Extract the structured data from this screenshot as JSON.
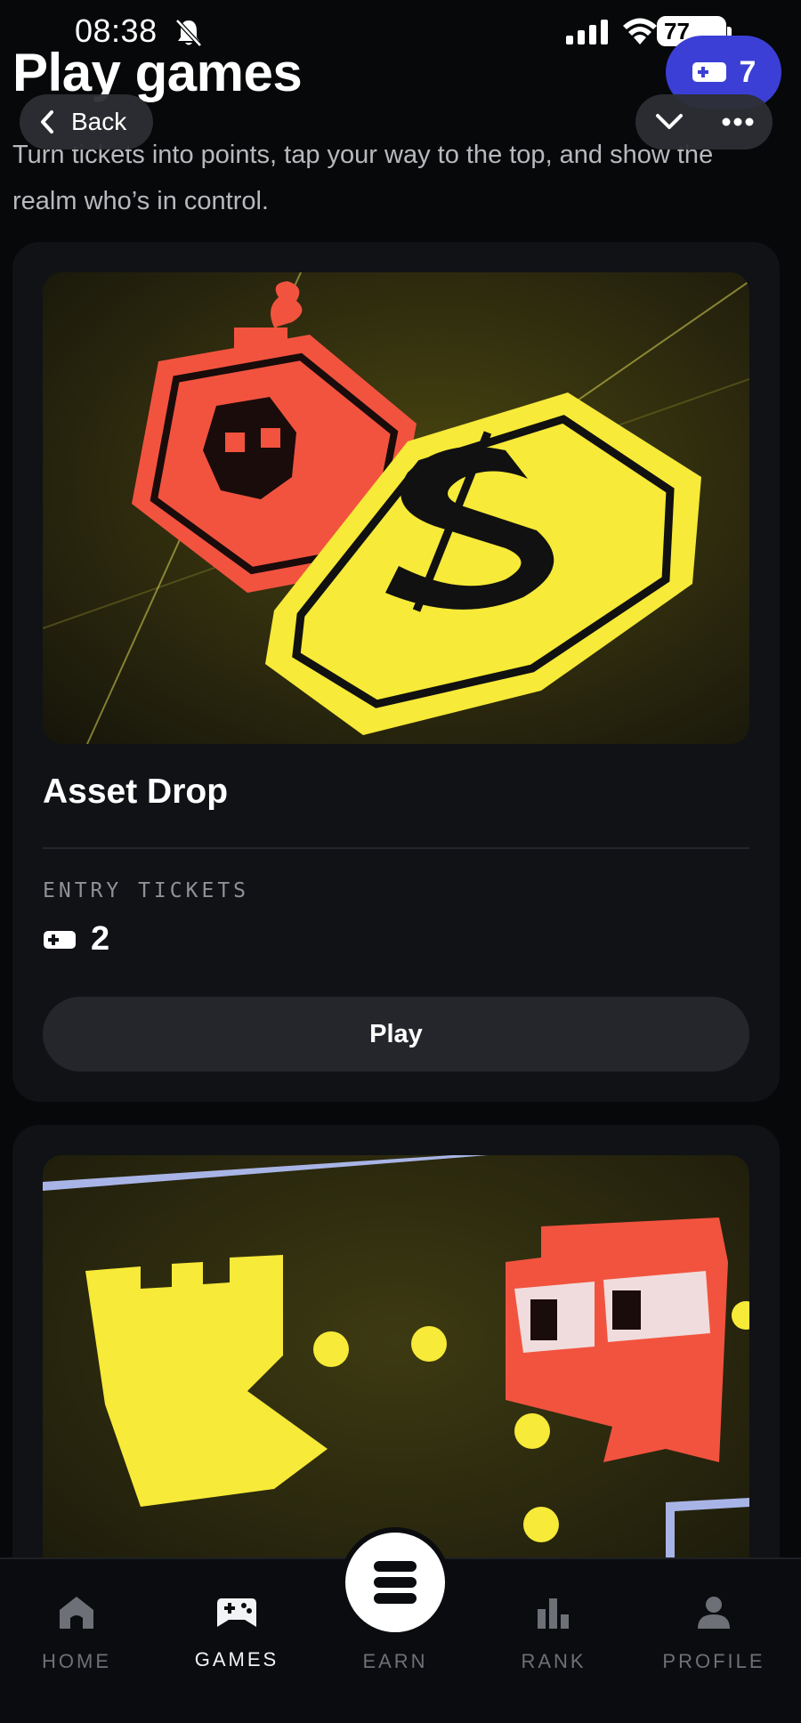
{
  "status_bar": {
    "time": "08:38",
    "battery": "77"
  },
  "header": {
    "title": "Play games",
    "subtitle": "Turn tickets into points, tap your way to the top, and show the realm who’s in control.",
    "ticket_count": "7",
    "back_label": "Back"
  },
  "games": [
    {
      "title": "Asset Drop",
      "entry_label": "ENTRY TICKETS",
      "entry_value": "2",
      "play_label": "Play"
    }
  ],
  "nav": {
    "items": [
      {
        "label": "HOME"
      },
      {
        "label": "GAMES"
      },
      {
        "label": "EARN"
      },
      {
        "label": "RANK"
      },
      {
        "label": "PROFILE"
      }
    ],
    "active": "GAMES"
  },
  "colors": {
    "accent": "#3b3fd6",
    "background": "#070809",
    "card": "#101216",
    "yellow": "#f7ea38",
    "red": "#f2533f"
  }
}
